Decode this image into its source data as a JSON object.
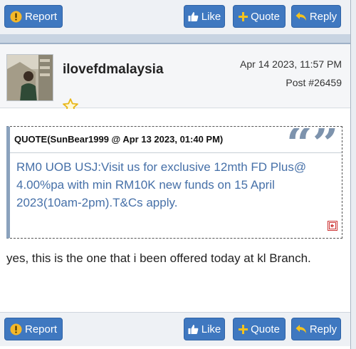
{
  "toolbar": {
    "report_label": "Report",
    "like_label": "Like",
    "quote_label": "Quote",
    "reply_label": "Reply"
  },
  "post": {
    "username": "ilovefdmalaysia",
    "date": "Apr 14 2023, 11:57 PM",
    "post_number": "Post #26459",
    "quote": {
      "header": "QUOTE(SunBear1999 @ Apr 13 2023, 01:40 PM)",
      "text": "RM0 UOB USJ:Visit us for exclusive 12mth FD Plus@ 4.00%pa with min RM10K new funds on 15 April 2023(10am-2pm).T&Cs apply."
    },
    "body": "yes, this is the one that i been offered today at kl Branch."
  },
  "colors": {
    "button": "#3f78c0",
    "quote_text": "#4670a8",
    "divider": "#c8d4e2",
    "star": "#e8b617"
  },
  "icons": {
    "report": "alert-circle-icon",
    "like": "thumbs-up-icon",
    "quote": "plus-icon",
    "reply": "reply-arrow-icon",
    "rank": "star-icon",
    "quote_mark": "quote-marks-icon",
    "goto": "go-to-post-icon"
  }
}
